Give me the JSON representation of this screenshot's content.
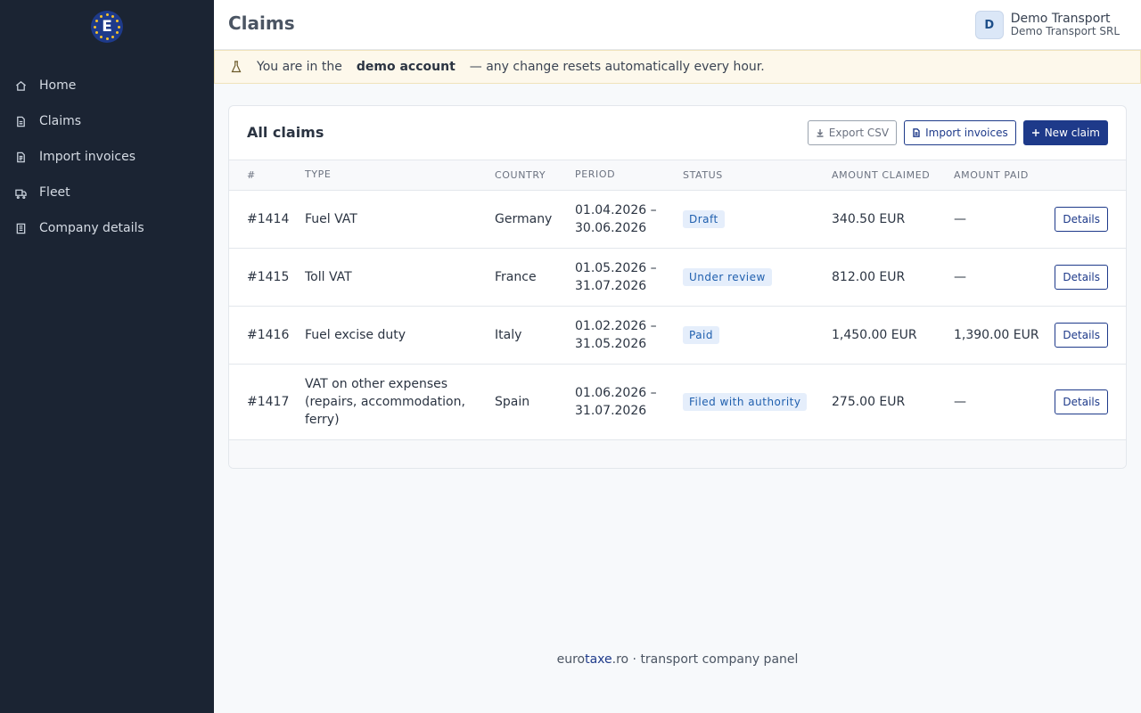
{
  "sidebar": {
    "logo_letter": "E",
    "items": [
      {
        "label": "Home",
        "icon": "home-icon"
      },
      {
        "label": "Claims",
        "icon": "document-icon"
      },
      {
        "label": "Import invoices",
        "icon": "file-import-icon"
      },
      {
        "label": "Fleet",
        "icon": "truck-icon"
      },
      {
        "label": "Company details",
        "icon": "building-icon"
      }
    ]
  },
  "header": {
    "title": "Claims",
    "user": {
      "initial": "D",
      "name": "Demo Transport",
      "company": "Demo Transport SRL"
    }
  },
  "banner": {
    "icon": "flask-icon",
    "prefix": "You are in the",
    "strong": "demo account",
    "suffix": "— any change resets automatically every hour."
  },
  "card": {
    "title": "All claims",
    "buttons": {
      "export": "Export CSV",
      "import": "Import invoices",
      "new": "New claim"
    },
    "columns": [
      "#",
      "Type",
      "Country",
      "Period",
      "Status",
      "Amount claimed",
      "Amount paid",
      ""
    ],
    "rows": [
      {
        "id": "#1414",
        "type": "Fuel VAT",
        "country": "Germany",
        "period_start": "01.04.2026 –",
        "period_end": "30.06.2026",
        "status": "Draft",
        "claimed": "340.50 EUR",
        "paid": "—",
        "action": "Details"
      },
      {
        "id": "#1415",
        "type": "Toll VAT",
        "country": "France",
        "period_start": "01.05.2026 –",
        "period_end": "31.07.2026",
        "status": "Under review",
        "claimed": "812.00 EUR",
        "paid": "—",
        "action": "Details"
      },
      {
        "id": "#1416",
        "type": "Fuel excise duty",
        "country": "Italy",
        "period_start": "01.02.2026 –",
        "period_end": "31.05.2026",
        "status": "Paid",
        "claimed": "1,450.00 EUR",
        "paid": "1,390.00 EUR",
        "action": "Details"
      },
      {
        "id": "#1417",
        "type": "VAT on other expenses (repairs, accommodation, ferry)",
        "country": "Spain",
        "period_start": "01.06.2026 –",
        "period_end": "31.07.2026",
        "status": "Filed with authority",
        "claimed": "275.00 EUR",
        "paid": "—",
        "action": "Details"
      }
    ]
  },
  "footer": {
    "part1": "euro",
    "part2": "taxe",
    "part3": ".ro · transport company panel"
  },
  "colors": {
    "sidebar_bg": "#1b2433",
    "brand": "#1e3a8a",
    "badge_text": "#1f5fae",
    "badge_bg": "#e5eefb",
    "banner_bg": "#fdf8eb"
  }
}
